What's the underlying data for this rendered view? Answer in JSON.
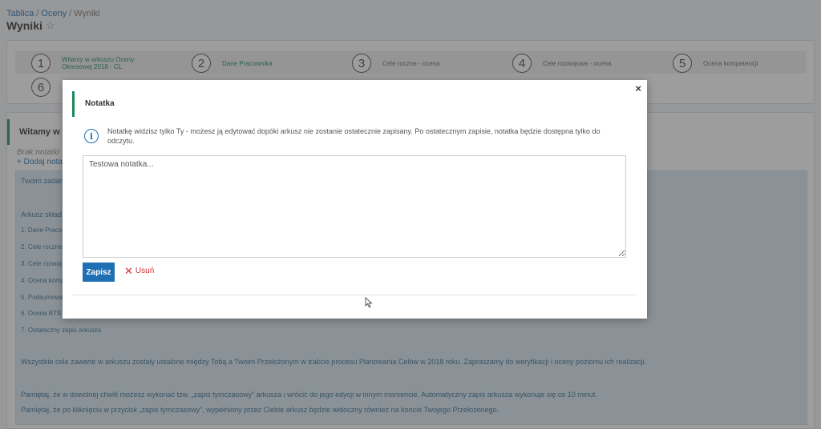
{
  "breadcrumb": {
    "items": [
      "Tablica",
      "Oceny",
      "Wyniki"
    ]
  },
  "page": {
    "title": "Wyniki",
    "favorite_icon": "star-outline-icon"
  },
  "steps": [
    {
      "number": "1",
      "label": "Witamy w arkuszu Oceny Okresowej 2018 - CL",
      "active": true
    },
    {
      "number": "2",
      "label": "Dane Pracownika",
      "active": true
    },
    {
      "number": "3",
      "label": "Cele roczne - ocena",
      "active": false
    },
    {
      "number": "4",
      "label": "Cele rozwojowe - ocena",
      "active": false
    },
    {
      "number": "5",
      "label": "Ocena kompetencji",
      "active": false
    },
    {
      "number": "6",
      "label": "",
      "active": false
    }
  ],
  "main": {
    "header": "Witamy w ar",
    "no_notes": "Brak notatki",
    "add_note": "+  Dodaj nota",
    "info_lines": [
      "Twoim zadan",
      "Arkusz skład",
      "1. Dane Praco",
      "2. Cele roczne -",
      "3. Cele rozwoj",
      "4. Ocena komp",
      "5. Podsumowa",
      "6. Ocena BTS",
      "7. Ostateczny zapis arkusza",
      "Wszystkie cele zawarte w arkuszu zostały ustalone między Tobą a Twoim Przełożonym w trakcie procesu Planowania Celów w 2018 roku. Zapraszamy do weryfikacji i oceny poziomu ich realizacji.",
      "Pamiętaj, że w dowolnej chwili możesz wykonać tzw. „zapis tymczasowy” arkusza i wrócić do jego edycji w innym momencie. Automatyczny zapis arkusza wykonuje się co 10 minut.",
      "Pamiętaj, że po kliknięciu w przycisk „zapis tymczasowy”, wypełniony przez Ciebie arkusz będzie widoczny również na koncie Twojego Przełożonego."
    ]
  },
  "modal": {
    "title": "Notatka",
    "close_label": "×",
    "info_icon": "info-circle-icon",
    "info_text": "Notatkę widzisz tylko Ty - możesz ją edytować dopóki arkusz nie zostanie ostatecznie zapisany. Po ostatecznym zapisie, notatka będzie dostępna tylko do odczytu.",
    "note_value": "Testowa notatka...",
    "save_label": "Zapisz",
    "delete_label": "Usuń"
  },
  "colors": {
    "accent_green": "#1a8a5a",
    "primary_blue": "#1f6fb5",
    "danger_red": "#d03030"
  }
}
